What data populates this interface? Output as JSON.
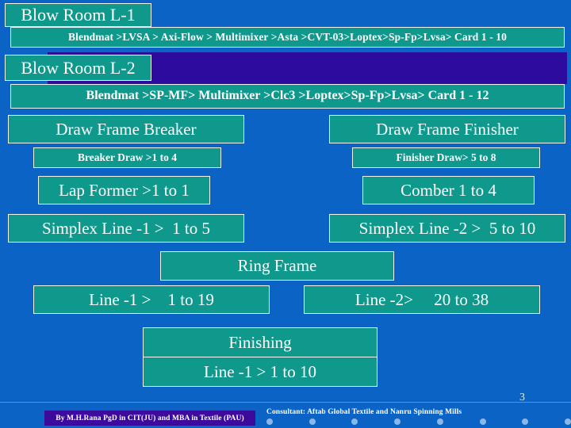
{
  "slide": {
    "page_number": "3",
    "background_color": "#0b63c5",
    "box_fill_color": "#0f998c",
    "box_border_color": "#f2f6f8",
    "accent_purple": "#2d0b9e",
    "text_color": "#ffffff"
  },
  "blow_room_1": {
    "title": "Blow Room L-1",
    "flow": "Blendmat >LVSA > Axi-Flow > Multimixer >Asta >CVT-03>Loptex>Sp-Fp>Lvsa> Card 1 - 10"
  },
  "blow_room_2": {
    "title": "Blow Room L-2",
    "flow": "Blendmat >SP-MF> Multimixer >Clc3 >Loptex>Sp-Fp>Lvsa> Card 1 - 12"
  },
  "draw_frame": {
    "breaker_title": "Draw Frame Breaker",
    "breaker_detail": "Breaker Draw >1 to 4",
    "finisher_title": "Draw Frame Finisher",
    "finisher_detail": "Finisher Draw> 5 to 8"
  },
  "preparatory": {
    "lap_former": "Lap Former >1 to 1",
    "comber": "Comber 1 to 4"
  },
  "simplex": {
    "line_1": "Simplex Line -1 >  1 to 5",
    "line_2": "Simplex Line -2 >  5 to 10"
  },
  "ring_frame": {
    "title": "Ring Frame",
    "line_1": "Line -1 >    1 to 19",
    "line_2": "Line -2>     20 to 38"
  },
  "finishing": {
    "title": "Finishing",
    "line_1": "Line -1 > 1 to 10"
  },
  "footer": {
    "author": "By M.H.Rana PgD in CIT(JU) and MBA in Textile (PAU)",
    "consultant": "Consultant: Aftab Global Textile and Nanru Spinning Mills",
    "dot_count": 8,
    "dot_color": "#89b8e8"
  }
}
